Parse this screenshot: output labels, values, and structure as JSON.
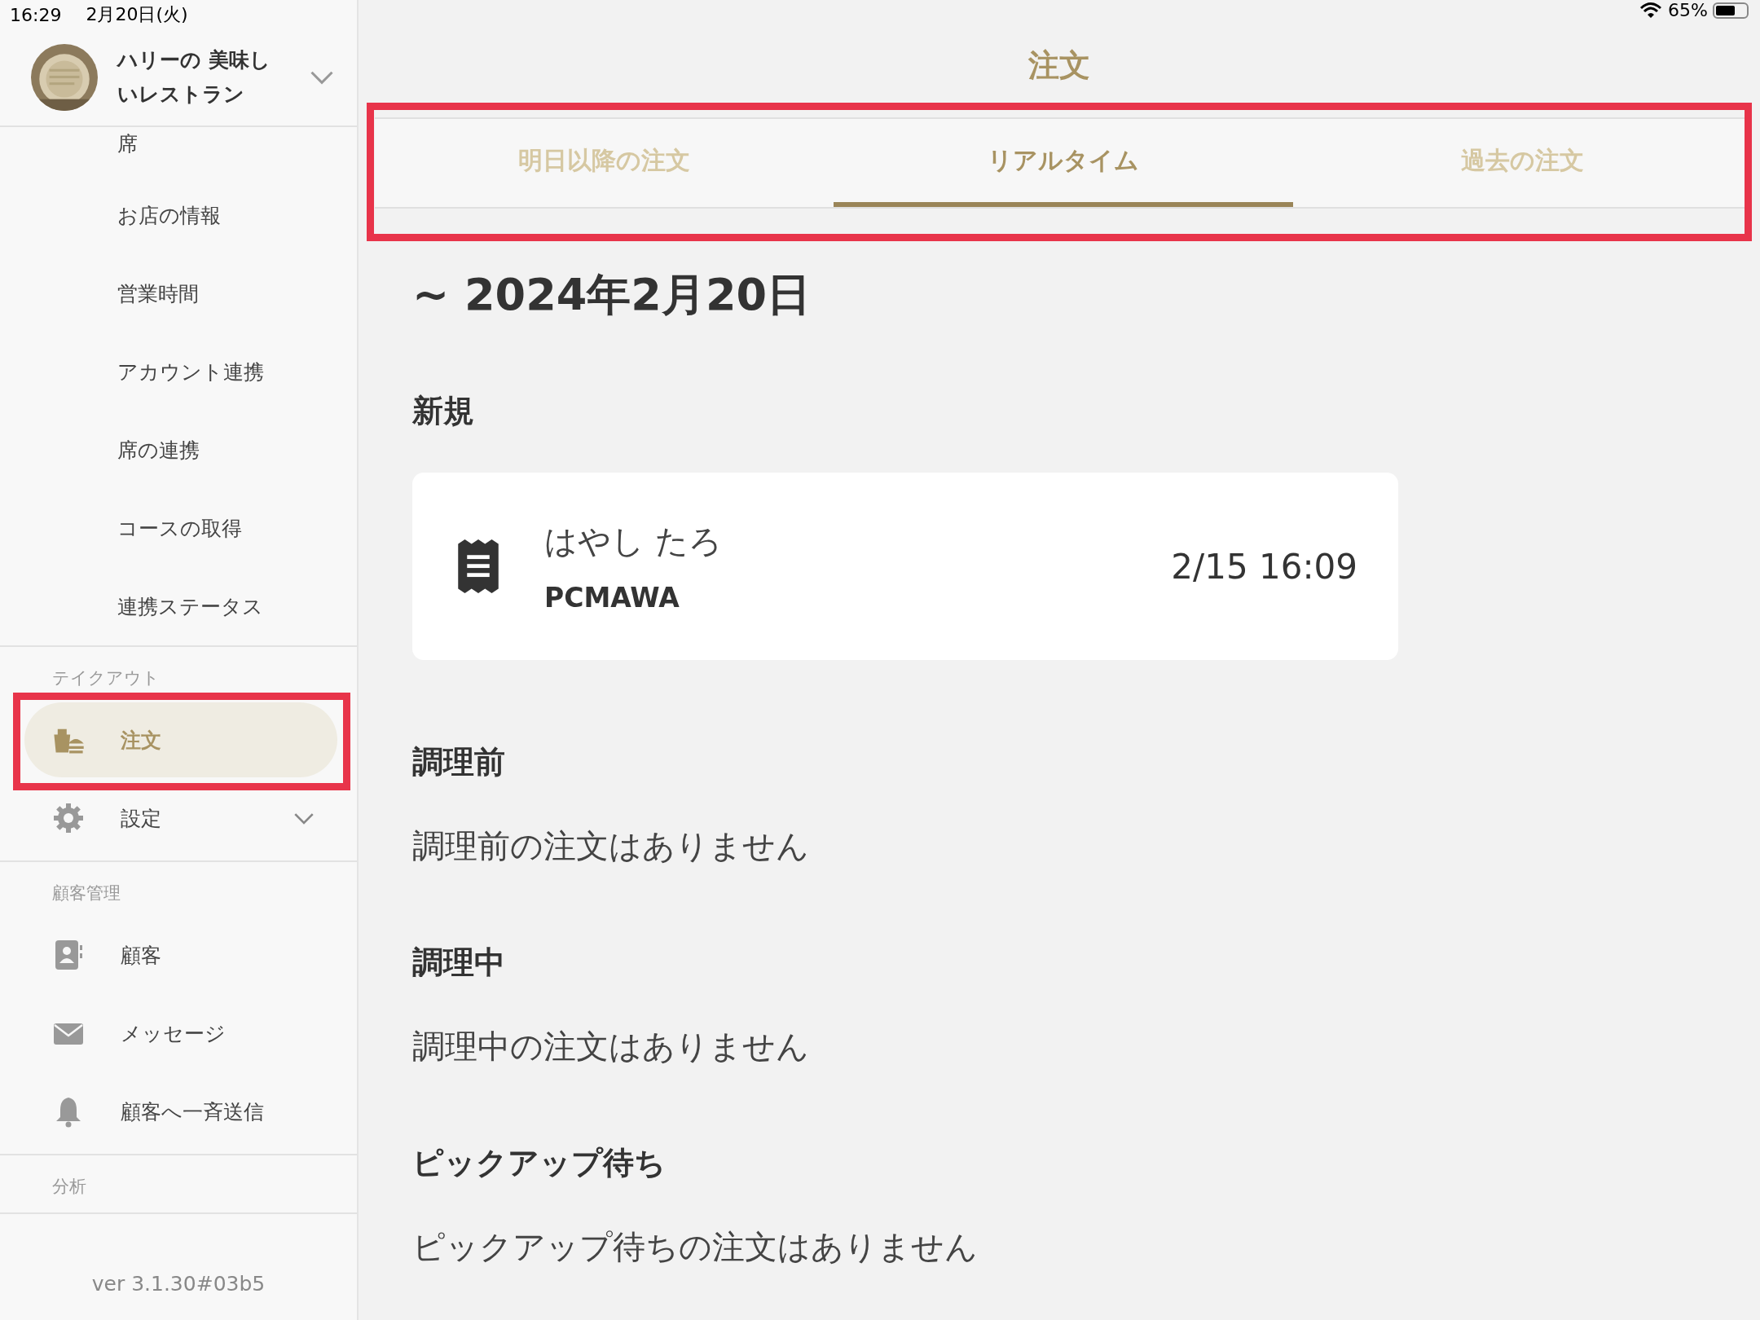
{
  "status_bar": {
    "time": "16:29",
    "date": "2月20日(火)",
    "battery": "65%"
  },
  "sidebar": {
    "restaurant_name": "ハリーの 美味しいレストラン",
    "menu_items": [
      "席",
      "お店の情報",
      "営業時間",
      "アカウント連携",
      "席の連携",
      "コースの取得",
      "連携ステータス"
    ],
    "sections": [
      {
        "title": "テイクアウト",
        "items": [
          {
            "label": "注文",
            "selected": true,
            "expandable": false,
            "highlighted": true
          },
          {
            "label": "設定",
            "selected": false,
            "expandable": true,
            "highlighted": false
          }
        ]
      },
      {
        "title": "顧客管理",
        "items": [
          {
            "label": "顧客",
            "selected": false,
            "expandable": false,
            "highlighted": false
          },
          {
            "label": "メッセージ",
            "selected": false,
            "expandable": false,
            "highlighted": false
          },
          {
            "label": "顧客へ一斉送信",
            "selected": false,
            "expandable": false,
            "highlighted": false
          }
        ]
      },
      {
        "title": "分析"
      }
    ],
    "version": "ver 3.1.30#03b5"
  },
  "main": {
    "title": "注文",
    "tabs_highlighted": true,
    "tabs": [
      {
        "label": "明日以降の注文",
        "selected": false
      },
      {
        "label": "リアルタイム",
        "selected": true
      },
      {
        "label": "過去の注文",
        "selected": false
      }
    ],
    "date_heading": "~ 2024年2月20日",
    "groups": [
      {
        "heading": "新規",
        "orders": [
          {
            "name": "はやし たろ",
            "code": "PCMAWA",
            "time": "2/15 16:09"
          }
        ]
      },
      {
        "heading": "調理前",
        "empty_text": "調理前の注文はありません"
      },
      {
        "heading": "調理中",
        "empty_text": "調理中の注文はありません"
      },
      {
        "heading": "ピックアップ待ち",
        "empty_text": "ピックアップ待ちの注文はありません"
      }
    ]
  }
}
